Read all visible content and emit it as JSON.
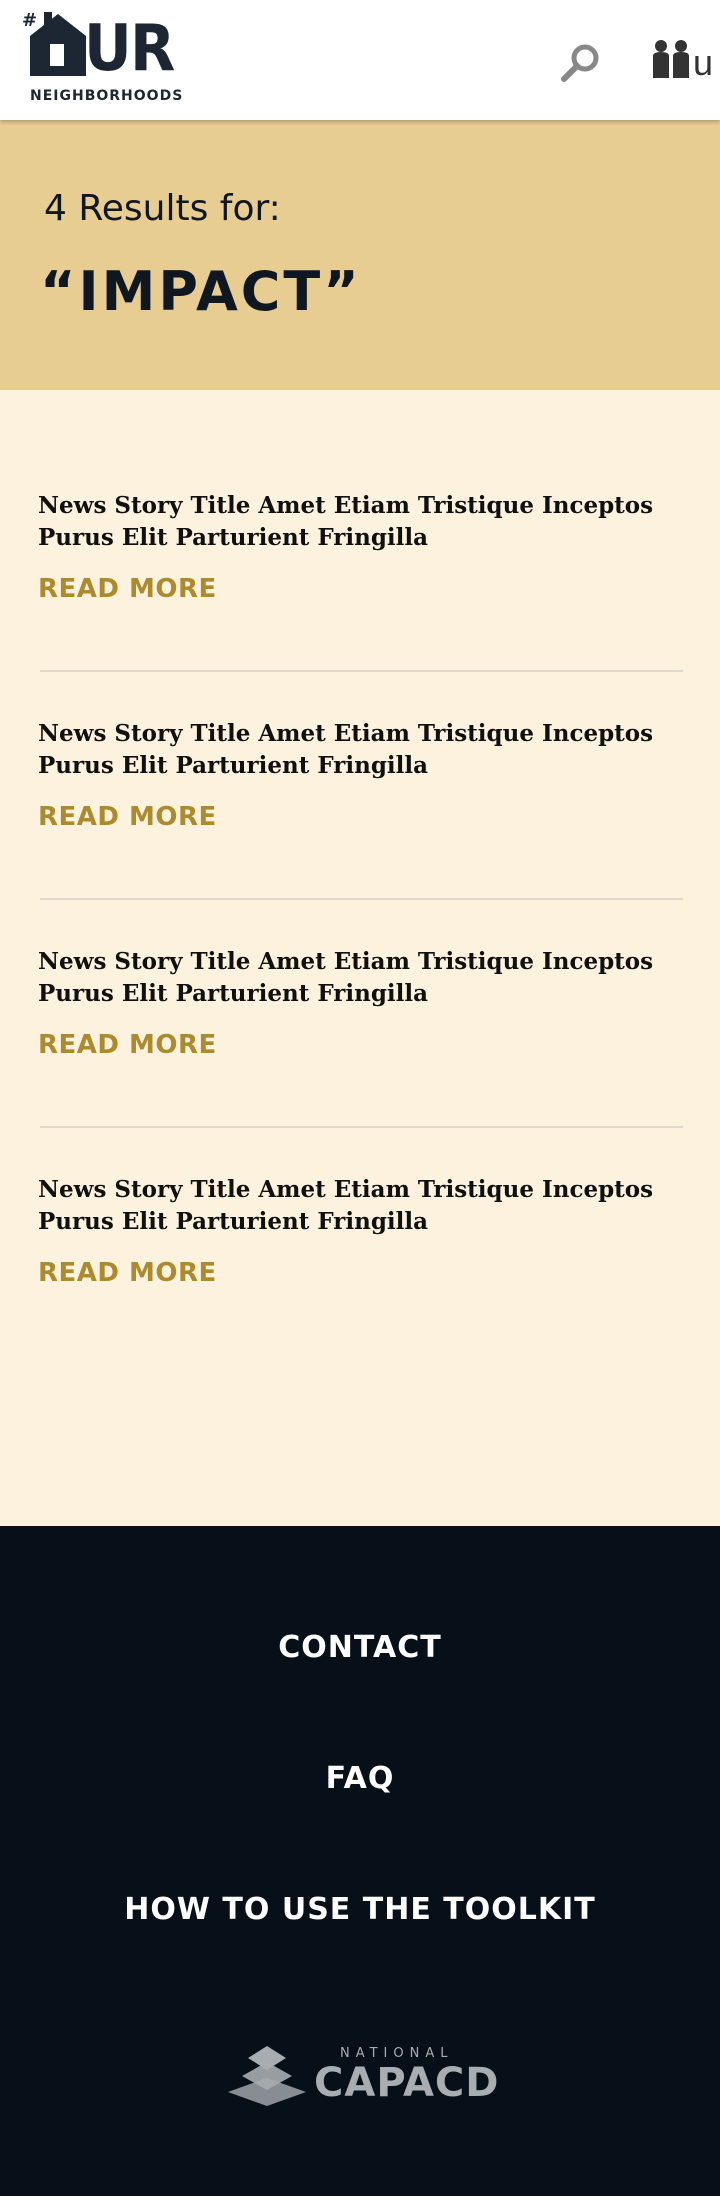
{
  "header": {
    "logo_hash": "#",
    "logo_main": "UR",
    "logo_sub": "NEIGHBORHOODS",
    "search_icon": "search-icon",
    "user_icon": "people-icon",
    "user_letter": "u",
    "icon_color": "#888888"
  },
  "hero": {
    "results_line": "4 Results for:",
    "query": "“IMPACT”",
    "background": "#e8cd93"
  },
  "results": [
    {
      "title": "News Story Title Amet Etiam Tristique Inceptos Purus Elit Parturient Fringilla",
      "link": "READ MORE"
    },
    {
      "title": "News Story Title Amet Etiam Tristique Inceptos Purus Elit Parturient Fringilla",
      "link": "READ MORE"
    },
    {
      "title": "News Story Title Amet Etiam Tristique Inceptos Purus Elit Parturient Fringilla",
      "link": "READ MORE"
    },
    {
      "title": "News Story Title Amet Etiam Tristique Inceptos Purus Elit Parturient Fringilla",
      "link": "READ MORE"
    }
  ],
  "footer": {
    "links": [
      "CONTACT",
      "FAQ",
      "HOW TO USE THE TOOLKIT"
    ],
    "org_national": "NATIONAL",
    "org_name": "CAPACD",
    "accent": "#ad8a2e",
    "background": "#071019"
  }
}
